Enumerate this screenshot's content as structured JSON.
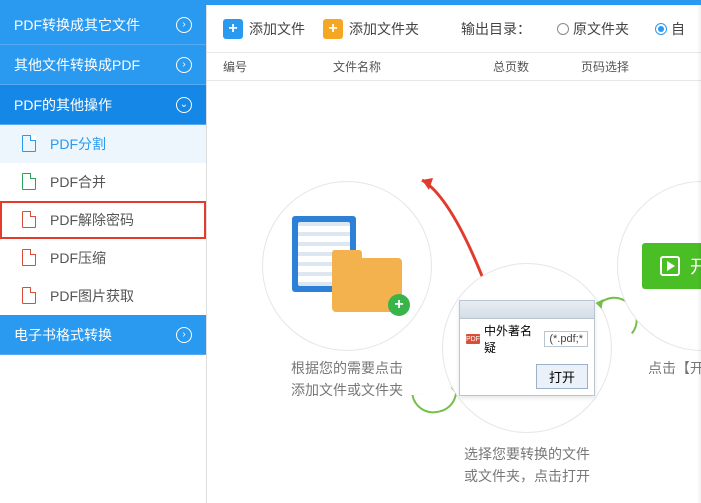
{
  "sidebar": {
    "sections": [
      {
        "label": "PDF转换成其它文件",
        "expanded": false
      },
      {
        "label": "其他文件转换成PDF",
        "expanded": false
      },
      {
        "label": "PDF的其他操作",
        "expanded": true
      },
      {
        "label": "电子书格式转换",
        "expanded": false
      }
    ],
    "items": [
      {
        "label": "PDF分割",
        "selected": true,
        "highlighted": false
      },
      {
        "label": "PDF合并",
        "selected": false,
        "highlighted": false
      },
      {
        "label": "PDF解除密码",
        "selected": false,
        "highlighted": true
      },
      {
        "label": "PDF压缩",
        "selected": false,
        "highlighted": false
      },
      {
        "label": "PDF图片获取",
        "selected": false,
        "highlighted": false
      }
    ]
  },
  "toolbar": {
    "add_file": "添加文件",
    "add_folder": "添加文件夹",
    "output_label": "输出目录：",
    "radio_original": "原文件夹",
    "radio_custom": "自"
  },
  "table": {
    "col1": "编号",
    "col2": "文件名称",
    "col3": "总页数",
    "col4": "页码选择"
  },
  "steps": {
    "step1_line1": "根据您的需要点击",
    "step1_line2": "添加文件或文件夹",
    "step2_line1": "选择您要转换的文件",
    "step2_line2": "或文件夹，点击打开",
    "step3_line1": "点击【开始转换",
    "start_label": "开始转",
    "dialog_filename": "中外著名疑",
    "dialog_filter": "(*.pdf;*",
    "dialog_pdf": "PDF",
    "open_btn": "打开"
  }
}
